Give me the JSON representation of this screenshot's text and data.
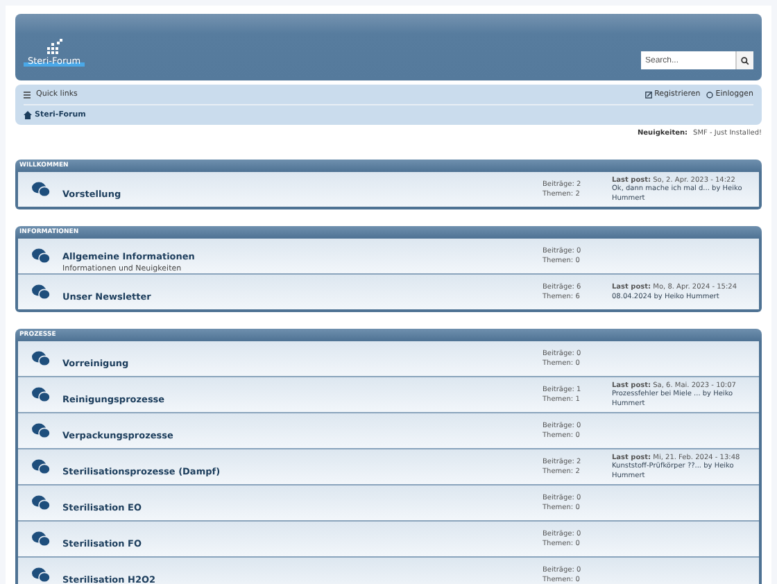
{
  "header": {
    "logo_text": "Steri-Forum",
    "search": {
      "placeholder": "Search..."
    }
  },
  "navbar": {
    "quick_links": "Quick links",
    "register": "Registrieren",
    "login": "Einloggen",
    "breadcrumb": "Steri-Forum"
  },
  "news": {
    "label": "Neuigkeiten:",
    "text": "SMF - Just Installed!"
  },
  "categories": [
    {
      "title": "WILLKOMMEN",
      "boards": [
        {
          "name": "Vorstellung",
          "posts": "Beiträge: 2",
          "topics": "Themen: 2",
          "last_post": "**Last post:** So, 2. Apr. 2023 - 14:22",
          "last_excerpt": "Ok, dann mache ich mal d... by Heiko Hummert"
        }
      ]
    },
    {
      "title": "INFORMATIONEN",
      "boards": [
        {
          "name": "Allgemeine Informationen",
          "description": "Informationen und Neuigkeiten",
          "posts": "Beiträge: 0",
          "topics": "Themen: 0"
        },
        {
          "name": "Unser Newsletter",
          "posts": "Beiträge: 6",
          "topics": "Themen: 6",
          "last_post": "**Last post:** Mo, 8. Apr. 2024 - 15:24",
          "last_excerpt": "08.04.2024 by Heiko Hummert"
        }
      ]
    },
    {
      "title": "PROZESSE",
      "boards": [
        {
          "name": "Vorreinigung",
          "posts": "Beiträge: 0",
          "topics": "Themen: 0"
        },
        {
          "name": "Reinigungsprozesse",
          "posts": "Beiträge: 1",
          "topics": "Themen: 1",
          "last_post": "**Last post:** Sa, 6. Mai. 2023 - 10:07",
          "last_excerpt": "Prozessfehler bei Miele ... by Heiko Hummert"
        },
        {
          "name": "Verpackungsprozesse",
          "posts": "Beiträge: 0",
          "topics": "Themen: 0"
        },
        {
          "name": "Sterilisationsprozesse (Dampf)",
          "posts": "Beiträge: 2",
          "topics": "Themen: 2",
          "last_post": "**Last post:** Mi, 21. Feb. 2024 - 13:48",
          "last_excerpt": "Kunststoff-Prüfkörper ??... by Heiko Hummert"
        },
        {
          "name": "Sterilisation EO",
          "posts": "Beiträge: 0",
          "topics": "Themen: 0"
        },
        {
          "name": "Sterilisation FO",
          "posts": "Beiträge: 0",
          "topics": "Themen: 0"
        },
        {
          "name": "Sterilisation H2O2",
          "posts": "Beiträge: 0",
          "topics": "Themen: 0"
        }
      ]
    }
  ]
}
